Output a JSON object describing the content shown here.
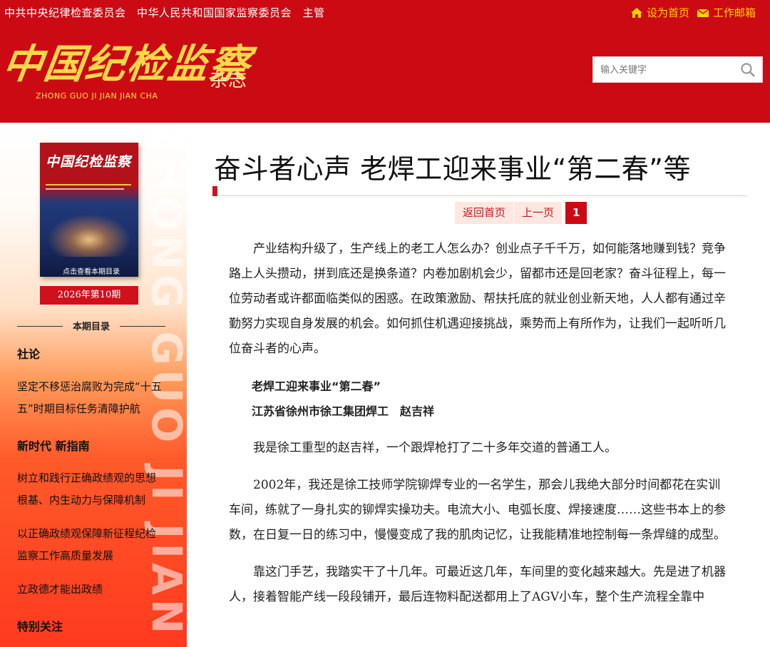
{
  "topbar": {
    "supervisors": "中共中央纪律检查委员会　中华人民共和国国家监察委员会　主管",
    "home_label": "设为首页",
    "mail_label": "工作邮箱"
  },
  "logo": {
    "chinese": "中国纪检监察",
    "pinyin": "ZHONG GUO JI JIAN JIAN CHA",
    "suffix": "杂志"
  },
  "search": {
    "placeholder": "输入关键字"
  },
  "sidebar": {
    "watermark": "ZHONG GUO JI JIAN",
    "cover_title": "中国纪检监察",
    "cover_caption": "点击查看本期目录",
    "issue": "2026年第10期",
    "toc_heading": "本期目录",
    "toc": [
      {
        "type": "section",
        "label": "社论"
      },
      {
        "type": "item",
        "label": "坚定不移惩治腐败为完成“十五五”时期目标任务清障护航"
      },
      {
        "type": "section",
        "label": "新时代 新指南"
      },
      {
        "type": "item",
        "label": "树立和践行正确政绩观的思想根基、内生动力与保障机制"
      },
      {
        "type": "item",
        "label": "以正确政绩观保障新征程纪检监察工作高质量发展"
      },
      {
        "type": "item",
        "label": "立政德才能出政绩"
      },
      {
        "type": "section",
        "label": "特别关注"
      }
    ]
  },
  "article": {
    "title": "奋斗者心声 老焊工迎来事业“第二春”等",
    "pager": {
      "home": "返回首页",
      "prev": "上一页",
      "current": "1"
    },
    "intro": "产业结构升级了，生产线上的老工人怎么办？创业点子千千万，如何能落地赚到钱？竞争路上人头攒动，拼到底还是换条道？内卷加剧机会少，留都市还是回老家？奋斗征程上，每一位劳动者或许都面临类似的困惑。在政策激励、帮扶托底的就业创业新天地，人人都有通过辛勤努力实现自身发展的机会。如何抓住机遇迎接挑战，乘势而上有所作为，让我们一起听听几位奋斗者的心声。",
    "subtitle": "老焊工迎来事业“第二春”",
    "author": "江苏省徐州市徐工集团焊工　赵吉祥",
    "p1": "我是徐工重型的赵吉祥，一个跟焊枪打了二十多年交道的普通工人。",
    "p2": "2002年，我还是徐工技师学院铆焊专业的一名学生，那会儿我绝大部分时间都花在实训车间，练就了一身扎实的铆焊实操功夫。电流大小、电弧长度、焊接速度……这些书本上的参数，在日复一日的练习中，慢慢变成了我的肌肉记忆，让我能精准地控制每一条焊缝的成型。",
    "p3": "靠这门手艺，我踏实干了十几年。可最近这几年，车间里的变化越来越大。先是进了机器人，接着智能产线一段段铺开，最后连物料配送都用上了AGV小车，整个生产流程全靠中"
  }
}
